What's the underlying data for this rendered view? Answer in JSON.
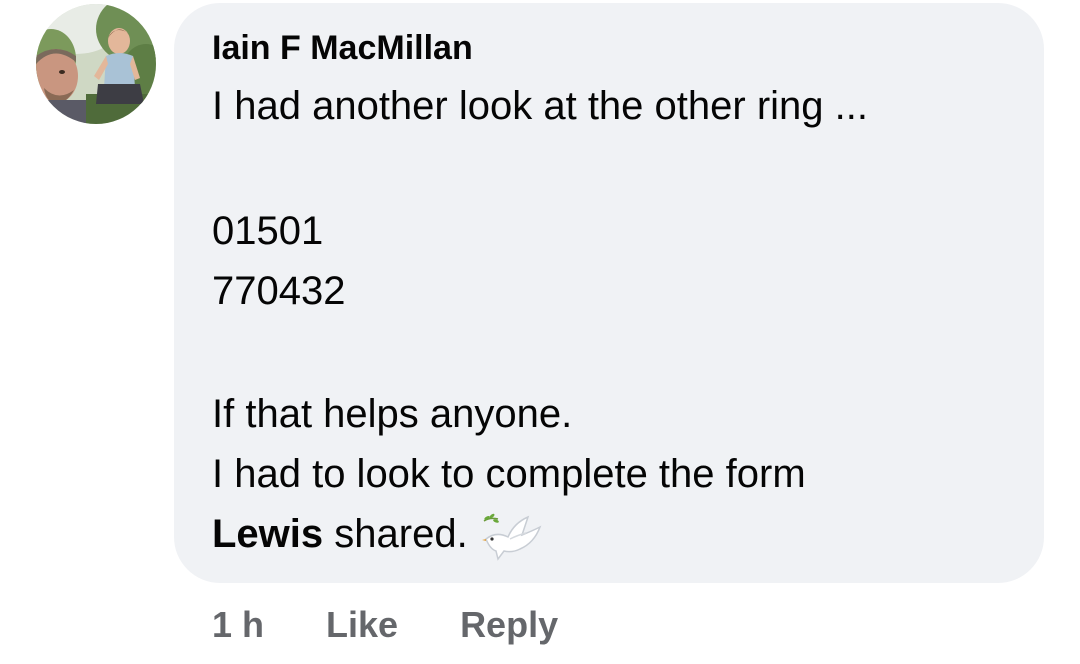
{
  "comment": {
    "author": "Iain F MacMillan",
    "lines": [
      "I had another look at the other ring ...",
      "01501",
      "770432",
      "If that helps anyone.",
      "I had to look to complete the form"
    ],
    "mention": "Lewis",
    "last_line_rest": " shared.",
    "emoji_icon": "dove-icon",
    "bubble_color": "#f0f2f5"
  },
  "actions": {
    "time": "1 h",
    "like_label": "Like",
    "reply_label": "Reply",
    "color": "#65676b"
  }
}
